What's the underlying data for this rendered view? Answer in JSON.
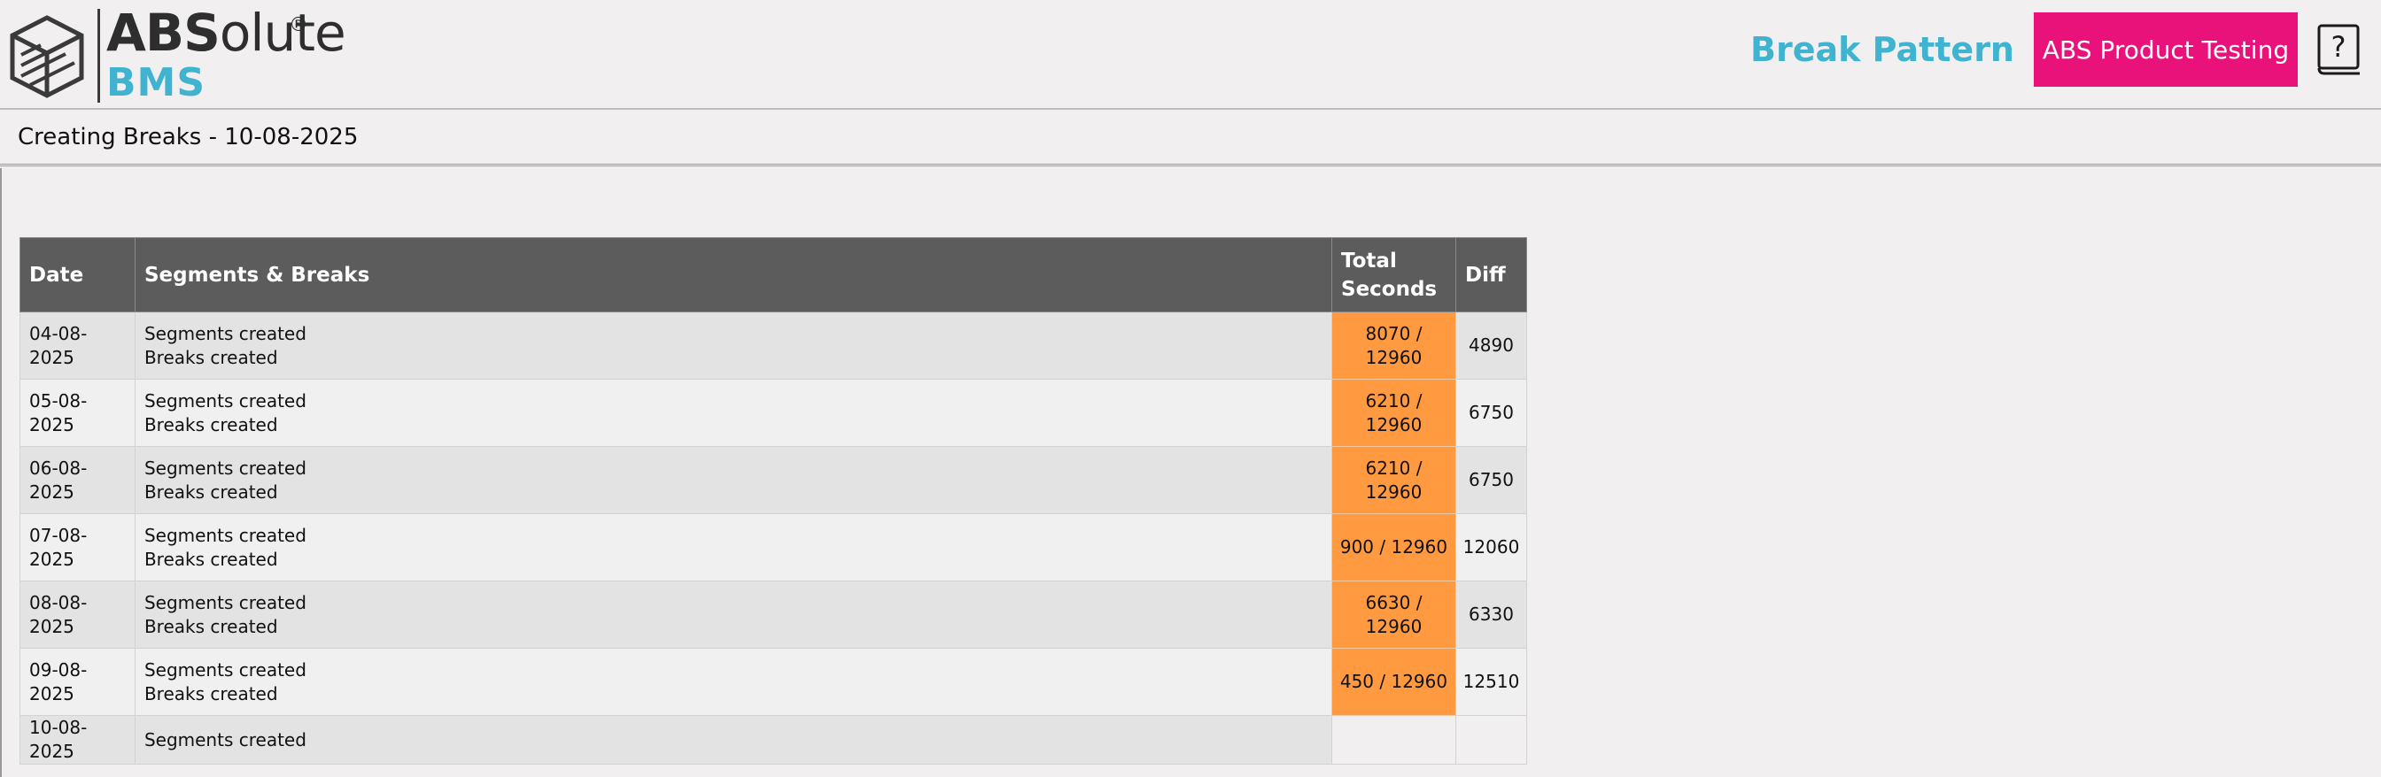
{
  "header": {
    "logo_text_bold": "ABS",
    "logo_text_rest": "olute",
    "logo_reg": "®",
    "logo_sub": "BMS",
    "page_heading": "Break Pattern",
    "product_button": "ABS Product Testing",
    "help_icon": "help-book-icon",
    "brand_color": "#3fb3cf",
    "accent_color": "#e8127a"
  },
  "subheader": {
    "title": "Creating Breaks - 10-08-2025"
  },
  "table": {
    "columns": {
      "date": "Date",
      "segments": "Segments & Breaks",
      "total_line1": "Total",
      "total_line2": "Seconds",
      "diff": "Diff"
    },
    "highlight_color": "#ff9a40",
    "rows": [
      {
        "date": "04-08-2025",
        "line1": "Segments created",
        "line2": "Breaks created",
        "total": "8070 / 12960",
        "diff": "4890"
      },
      {
        "date": "05-08-2025",
        "line1": "Segments created",
        "line2": "Breaks created",
        "total": "6210 / 12960",
        "diff": "6750"
      },
      {
        "date": "06-08-2025",
        "line1": "Segments created",
        "line2": "Breaks created",
        "total": "6210 / 12960",
        "diff": "6750"
      },
      {
        "date": "07-08-2025",
        "line1": "Segments created",
        "line2": "Breaks created",
        "total": "900 / 12960",
        "diff": "12060"
      },
      {
        "date": "08-08-2025",
        "line1": "Segments created",
        "line2": "Breaks created",
        "total": "6630 / 12960",
        "diff": "6330"
      },
      {
        "date": "09-08-2025",
        "line1": "Segments created",
        "line2": "Breaks created",
        "total": "450 / 12960",
        "diff": "12510"
      },
      {
        "date": "10-08-2025",
        "line1": "Segments created"
      }
    ]
  }
}
